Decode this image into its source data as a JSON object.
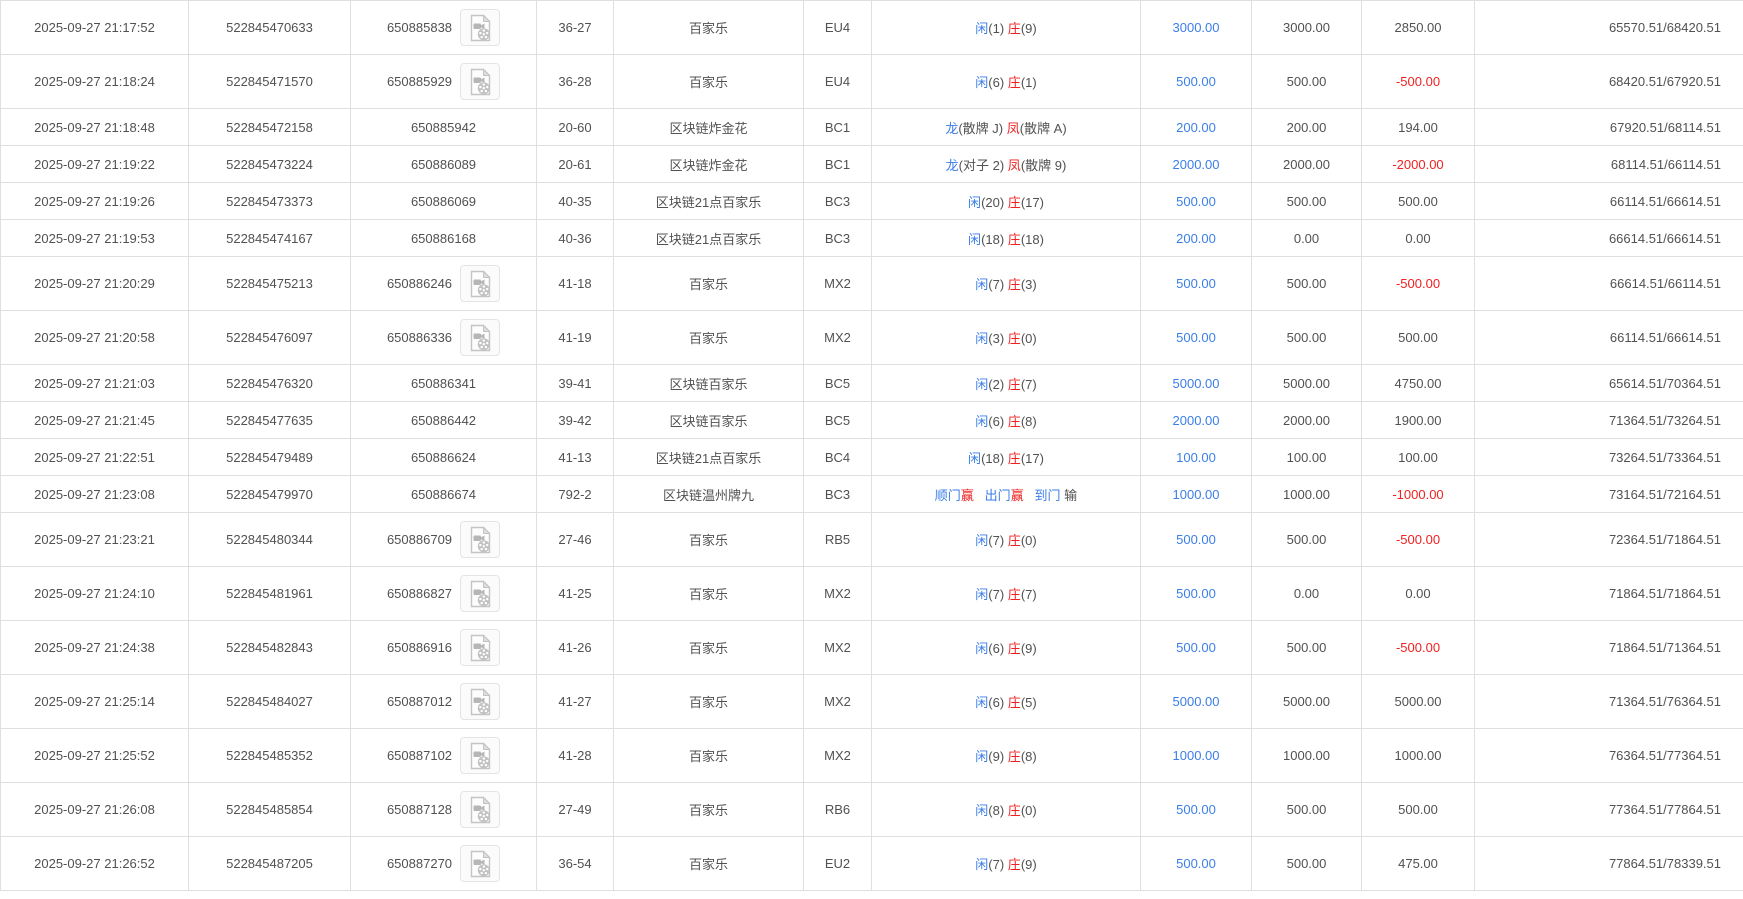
{
  "colors": {
    "accent_blue": "#3b7ee8",
    "loss_red": "#ee2222",
    "text": "#515151",
    "border": "#dfdfdf",
    "icon_gray": "#bdbdbd"
  },
  "icons": {
    "video_replay": "video-file-icon"
  },
  "rows": [
    {
      "time": "2025-09-27 21:17:52",
      "bet_id": "522845470633",
      "round_id": "650885838",
      "has_video": true,
      "table_round": "36-27",
      "game": "百家乐",
      "table_code": "EU4",
      "result": [
        {
          "text": "闲",
          "color": "blue"
        },
        {
          "text": "(1) ",
          "color": "plain"
        },
        {
          "text": "庄",
          "color": "red"
        },
        {
          "text": "(9)",
          "color": "plain"
        }
      ],
      "bet": "3000.00",
      "valid_bet": "3000.00",
      "win_loss": "2850.00",
      "balance": "65570.51/68420.51"
    },
    {
      "time": "2025-09-27 21:18:24",
      "bet_id": "522845471570",
      "round_id": "650885929",
      "has_video": true,
      "table_round": "36-28",
      "game": "百家乐",
      "table_code": "EU4",
      "result": [
        {
          "text": "闲",
          "color": "blue"
        },
        {
          "text": "(6) ",
          "color": "plain"
        },
        {
          "text": "庄",
          "color": "red"
        },
        {
          "text": "(1)",
          "color": "plain"
        }
      ],
      "bet": "500.00",
      "valid_bet": "500.00",
      "win_loss": "-500.00",
      "balance": "68420.51/67920.51"
    },
    {
      "time": "2025-09-27 21:18:48",
      "bet_id": "522845472158",
      "round_id": "650885942",
      "has_video": false,
      "table_round": "20-60",
      "game": "区块链炸金花",
      "table_code": "BC1",
      "result": [
        {
          "text": "龙",
          "color": "blue"
        },
        {
          "text": "(散牌 J) ",
          "color": "plain"
        },
        {
          "text": "凤",
          "color": "red"
        },
        {
          "text": "(散牌 A)",
          "color": "plain"
        }
      ],
      "bet": "200.00",
      "valid_bet": "200.00",
      "win_loss": "194.00",
      "balance": "67920.51/68114.51"
    },
    {
      "time": "2025-09-27 21:19:22",
      "bet_id": "522845473224",
      "round_id": "650886089",
      "has_video": false,
      "table_round": "20-61",
      "game": "区块链炸金花",
      "table_code": "BC1",
      "result": [
        {
          "text": "龙",
          "color": "blue"
        },
        {
          "text": "(对子 2) ",
          "color": "plain"
        },
        {
          "text": "凤",
          "color": "red"
        },
        {
          "text": "(散牌 9)",
          "color": "plain"
        }
      ],
      "bet": "2000.00",
      "valid_bet": "2000.00",
      "win_loss": "-2000.00",
      "balance": "68114.51/66114.51"
    },
    {
      "time": "2025-09-27 21:19:26",
      "bet_id": "522845473373",
      "round_id": "650886069",
      "has_video": false,
      "table_round": "40-35",
      "game": "区块链21点百家乐",
      "table_code": "BC3",
      "result": [
        {
          "text": "闲",
          "color": "blue"
        },
        {
          "text": "(20) ",
          "color": "plain"
        },
        {
          "text": "庄",
          "color": "red"
        },
        {
          "text": "(17)",
          "color": "plain"
        }
      ],
      "bet": "500.00",
      "valid_bet": "500.00",
      "win_loss": "500.00",
      "balance": "66114.51/66614.51"
    },
    {
      "time": "2025-09-27 21:19:53",
      "bet_id": "522845474167",
      "round_id": "650886168",
      "has_video": false,
      "table_round": "40-36",
      "game": "区块链21点百家乐",
      "table_code": "BC3",
      "result": [
        {
          "text": "闲",
          "color": "blue"
        },
        {
          "text": "(18) ",
          "color": "plain"
        },
        {
          "text": "庄",
          "color": "red"
        },
        {
          "text": "(18)",
          "color": "plain"
        }
      ],
      "bet": "200.00",
      "valid_bet": "0.00",
      "win_loss": "0.00",
      "balance": "66614.51/66614.51"
    },
    {
      "time": "2025-09-27 21:20:29",
      "bet_id": "522845475213",
      "round_id": "650886246",
      "has_video": true,
      "table_round": "41-18",
      "game": "百家乐",
      "table_code": "MX2",
      "result": [
        {
          "text": "闲",
          "color": "blue"
        },
        {
          "text": "(7) ",
          "color": "plain"
        },
        {
          "text": "庄",
          "color": "red"
        },
        {
          "text": "(3)",
          "color": "plain"
        }
      ],
      "bet": "500.00",
      "valid_bet": "500.00",
      "win_loss": "-500.00",
      "balance": "66614.51/66114.51"
    },
    {
      "time": "2025-09-27 21:20:58",
      "bet_id": "522845476097",
      "round_id": "650886336",
      "has_video": true,
      "table_round": "41-19",
      "game": "百家乐",
      "table_code": "MX2",
      "result": [
        {
          "text": "闲",
          "color": "blue"
        },
        {
          "text": "(3) ",
          "color": "plain"
        },
        {
          "text": "庄",
          "color": "red"
        },
        {
          "text": "(0)",
          "color": "plain"
        }
      ],
      "bet": "500.00",
      "valid_bet": "500.00",
      "win_loss": "500.00",
      "balance": "66114.51/66614.51"
    },
    {
      "time": "2025-09-27 21:21:03",
      "bet_id": "522845476320",
      "round_id": "650886341",
      "has_video": false,
      "table_round": "39-41",
      "game": "区块链百家乐",
      "table_code": "BC5",
      "result": [
        {
          "text": "闲",
          "color": "blue"
        },
        {
          "text": "(2) ",
          "color": "plain"
        },
        {
          "text": "庄",
          "color": "red"
        },
        {
          "text": "(7)",
          "color": "plain"
        }
      ],
      "bet": "5000.00",
      "valid_bet": "5000.00",
      "win_loss": "4750.00",
      "balance": "65614.51/70364.51"
    },
    {
      "time": "2025-09-27 21:21:45",
      "bet_id": "522845477635",
      "round_id": "650886442",
      "has_video": false,
      "table_round": "39-42",
      "game": "区块链百家乐",
      "table_code": "BC5",
      "result": [
        {
          "text": "闲",
          "color": "blue"
        },
        {
          "text": "(6) ",
          "color": "plain"
        },
        {
          "text": "庄",
          "color": "red"
        },
        {
          "text": "(8)",
          "color": "plain"
        }
      ],
      "bet": "2000.00",
      "valid_bet": "2000.00",
      "win_loss": "1900.00",
      "balance": "71364.51/73264.51"
    },
    {
      "time": "2025-09-27 21:22:51",
      "bet_id": "522845479489",
      "round_id": "650886624",
      "has_video": false,
      "table_round": "41-13",
      "game": "区块链21点百家乐",
      "table_code": "BC4",
      "result": [
        {
          "text": "闲",
          "color": "blue"
        },
        {
          "text": "(18) ",
          "color": "plain"
        },
        {
          "text": "庄",
          "color": "red"
        },
        {
          "text": "(17)",
          "color": "plain"
        }
      ],
      "bet": "100.00",
      "valid_bet": "100.00",
      "win_loss": "100.00",
      "balance": "73264.51/73364.51"
    },
    {
      "time": "2025-09-27 21:23:08",
      "bet_id": "522845479970",
      "round_id": "650886674",
      "has_video": false,
      "table_round": "792-2",
      "game": "区块链温州牌九",
      "table_code": "BC3",
      "result": [
        {
          "text": "顺门",
          "color": "blue"
        },
        {
          "text": "赢",
          "color": "red"
        },
        {
          "text": "   ",
          "color": "plain"
        },
        {
          "text": "出门",
          "color": "blue"
        },
        {
          "text": "赢",
          "color": "red"
        },
        {
          "text": "   ",
          "color": "plain"
        },
        {
          "text": "到门",
          "color": "blue"
        },
        {
          "text": " 输",
          "color": "plain"
        }
      ],
      "bet": "1000.00",
      "valid_bet": "1000.00",
      "win_loss": "-1000.00",
      "balance": "73164.51/72164.51"
    },
    {
      "time": "2025-09-27 21:23:21",
      "bet_id": "522845480344",
      "round_id": "650886709",
      "has_video": true,
      "table_round": "27-46",
      "game": "百家乐",
      "table_code": "RB5",
      "result": [
        {
          "text": "闲",
          "color": "blue"
        },
        {
          "text": "(7) ",
          "color": "plain"
        },
        {
          "text": "庄",
          "color": "red"
        },
        {
          "text": "(0)",
          "color": "plain"
        }
      ],
      "bet": "500.00",
      "valid_bet": "500.00",
      "win_loss": "-500.00",
      "balance": "72364.51/71864.51"
    },
    {
      "time": "2025-09-27 21:24:10",
      "bet_id": "522845481961",
      "round_id": "650886827",
      "has_video": true,
      "table_round": "41-25",
      "game": "百家乐",
      "table_code": "MX2",
      "result": [
        {
          "text": "闲",
          "color": "blue"
        },
        {
          "text": "(7) ",
          "color": "plain"
        },
        {
          "text": "庄",
          "color": "red"
        },
        {
          "text": "(7)",
          "color": "plain"
        }
      ],
      "bet": "500.00",
      "valid_bet": "0.00",
      "win_loss": "0.00",
      "balance": "71864.51/71864.51"
    },
    {
      "time": "2025-09-27 21:24:38",
      "bet_id": "522845482843",
      "round_id": "650886916",
      "has_video": true,
      "table_round": "41-26",
      "game": "百家乐",
      "table_code": "MX2",
      "result": [
        {
          "text": "闲",
          "color": "blue"
        },
        {
          "text": "(6) ",
          "color": "plain"
        },
        {
          "text": "庄",
          "color": "red"
        },
        {
          "text": "(9)",
          "color": "plain"
        }
      ],
      "bet": "500.00",
      "valid_bet": "500.00",
      "win_loss": "-500.00",
      "balance": "71864.51/71364.51"
    },
    {
      "time": "2025-09-27 21:25:14",
      "bet_id": "522845484027",
      "round_id": "650887012",
      "has_video": true,
      "table_round": "41-27",
      "game": "百家乐",
      "table_code": "MX2",
      "result": [
        {
          "text": "闲",
          "color": "blue"
        },
        {
          "text": "(6) ",
          "color": "plain"
        },
        {
          "text": "庄",
          "color": "red"
        },
        {
          "text": "(5)",
          "color": "plain"
        }
      ],
      "bet": "5000.00",
      "valid_bet": "5000.00",
      "win_loss": "5000.00",
      "balance": "71364.51/76364.51"
    },
    {
      "time": "2025-09-27 21:25:52",
      "bet_id": "522845485352",
      "round_id": "650887102",
      "has_video": true,
      "table_round": "41-28",
      "game": "百家乐",
      "table_code": "MX2",
      "result": [
        {
          "text": "闲",
          "color": "blue"
        },
        {
          "text": "(9) ",
          "color": "plain"
        },
        {
          "text": "庄",
          "color": "red"
        },
        {
          "text": "(8)",
          "color": "plain"
        }
      ],
      "bet": "1000.00",
      "valid_bet": "1000.00",
      "win_loss": "1000.00",
      "balance": "76364.51/77364.51"
    },
    {
      "time": "2025-09-27 21:26:08",
      "bet_id": "522845485854",
      "round_id": "650887128",
      "has_video": true,
      "table_round": "27-49",
      "game": "百家乐",
      "table_code": "RB6",
      "result": [
        {
          "text": "闲",
          "color": "blue"
        },
        {
          "text": "(8) ",
          "color": "plain"
        },
        {
          "text": "庄",
          "color": "red"
        },
        {
          "text": "(0)",
          "color": "plain"
        }
      ],
      "bet": "500.00",
      "valid_bet": "500.00",
      "win_loss": "500.00",
      "balance": "77364.51/77864.51"
    },
    {
      "time": "2025-09-27 21:26:52",
      "bet_id": "522845487205",
      "round_id": "650887270",
      "has_video": true,
      "table_round": "36-54",
      "game": "百家乐",
      "table_code": "EU2",
      "result": [
        {
          "text": "闲",
          "color": "blue"
        },
        {
          "text": "(7) ",
          "color": "plain"
        },
        {
          "text": "庄",
          "color": "red"
        },
        {
          "text": "(9)",
          "color": "plain"
        }
      ],
      "bet": "500.00",
      "valid_bet": "500.00",
      "win_loss": "475.00",
      "balance": "77864.51/78339.51"
    }
  ]
}
